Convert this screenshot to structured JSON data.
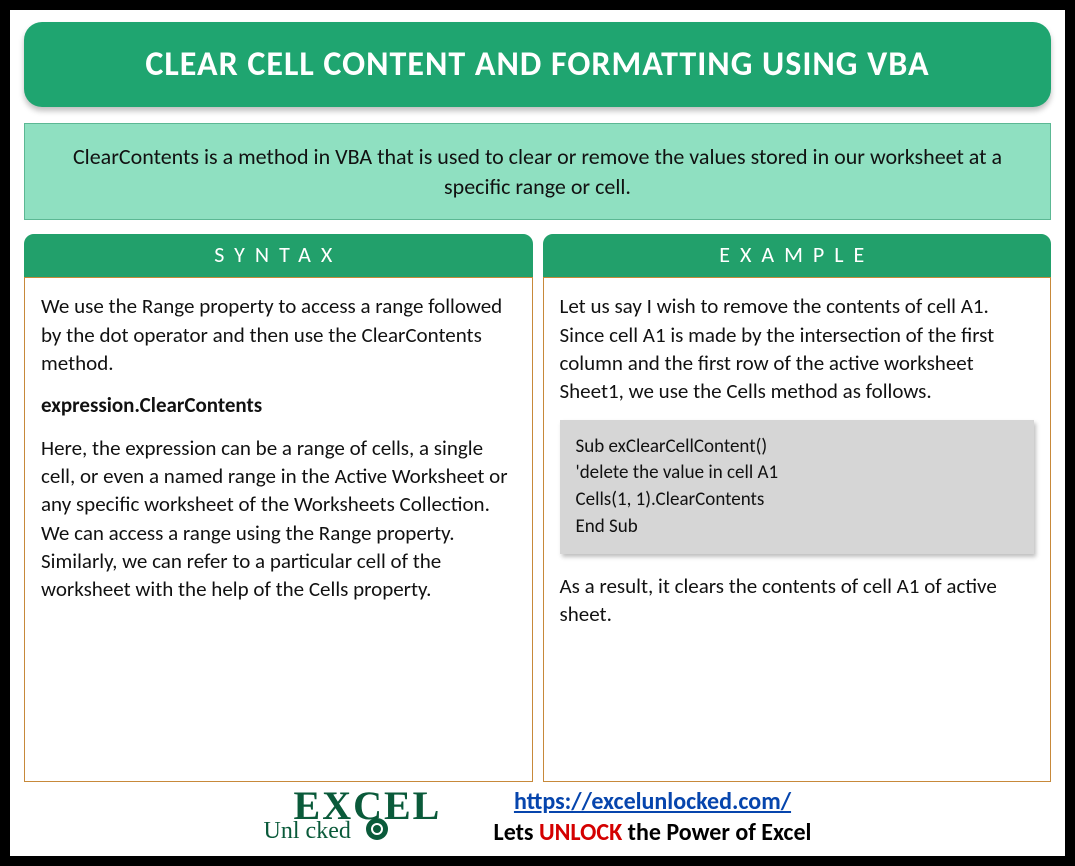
{
  "title": "CLEAR CELL CONTENT AND FORMATTING USING VBA",
  "description": "ClearContents is a method in VBA that is used to clear or remove the values stored in our worksheet at a specific range or cell.",
  "syntax": {
    "header": "SYNTAX",
    "para1": "We use the Range property to access a range followed by the dot operator and then use the ClearContents method.",
    "expression": "expression.ClearContents",
    "para2": "Here, the expression can be a range of cells, a single cell, or even a named range in the Active Worksheet or any specific worksheet of the Worksheets Collection. We can access a range using the Range property. Similarly, we can refer to a particular cell of the worksheet with the help of the Cells property."
  },
  "example": {
    "header": "EXAMPLE",
    "para1": "Let us say I wish to remove the contents of cell A1. Since cell A1 is made by the intersection of the first column and the first row of the active worksheet Sheet1, we use the Cells method as follows.",
    "code": "Sub exClearCellContent()\n'delete the value in cell A1\nCells(1, 1).ClearContents\nEnd Sub",
    "para2": "As a result, it clears the contents of cell A1 of active sheet."
  },
  "footer": {
    "logo_excel": "EXCEL",
    "logo_unlocked": "Unl   cked",
    "url": "https://excelunlocked.com/",
    "tagline_pre": "Lets ",
    "tagline_unlock": "UNLOCK",
    "tagline_post": " the Power of Excel"
  }
}
